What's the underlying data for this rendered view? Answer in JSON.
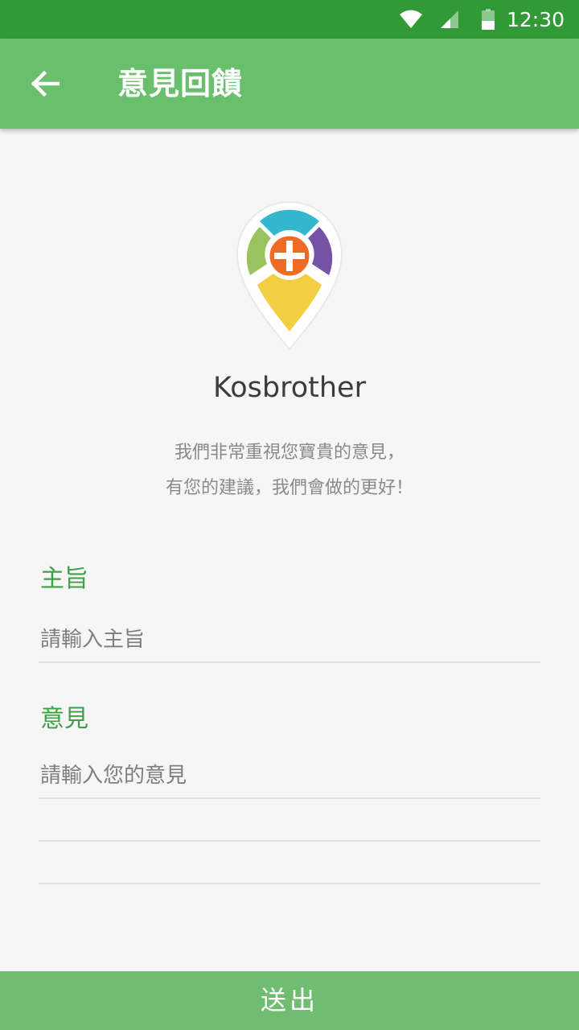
{
  "status_bar": {
    "time": "12:30",
    "icons": [
      "wifi-icon",
      "signal-icon",
      "battery-icon"
    ]
  },
  "app_bar": {
    "back_icon": "arrow-left-icon",
    "title": "意見回饋"
  },
  "logo": {
    "icon": "map-pin-plus-logo",
    "colors": {
      "top": "#33b7cf",
      "left": "#98c35f",
      "right": "#7452a4",
      "bottom": "#f2cf41",
      "center": "#ef6a24"
    }
  },
  "app_name": "Kosbrother",
  "intro": {
    "line1": "我們非常重視您寶貴的意見，",
    "line2": "有您的建議，我們會做的更好！"
  },
  "form": {
    "subject_label": "主旨",
    "subject_placeholder": "請輸入主旨",
    "opinion_label": "意見",
    "opinion_placeholder": "請輸入您的意見"
  },
  "submit_label": "送出",
  "colors": {
    "status_bar": "#319a36",
    "app_bar": "#6abf6d",
    "accent_label": "#3fa047",
    "submit_button": "#70bd72"
  }
}
